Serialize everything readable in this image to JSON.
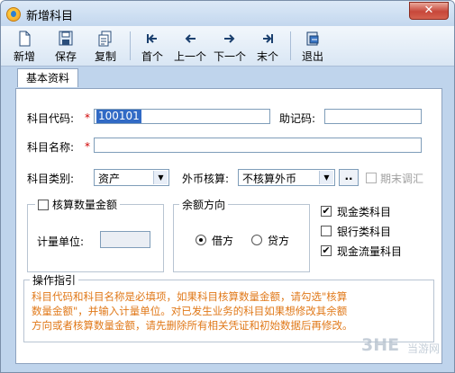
{
  "window": {
    "title": "新增科目",
    "close_label": "✕"
  },
  "toolbar": {
    "new": "新增",
    "save": "保存",
    "copy": "复制",
    "first": "首个",
    "prev": "上一个",
    "next": "下一个",
    "last": "末个",
    "exit": "退出"
  },
  "tab": {
    "basic": "基本资料"
  },
  "form": {
    "code_label": "科目代码:",
    "code_value": "100101",
    "mnemonic_label": "助记码:",
    "name_label": "科目名称:",
    "category_label": "科目类别:",
    "category_value": "资产",
    "currency_label": "外币核算:",
    "currency_value": "不核算外币",
    "dots_label": "..",
    "period_adjust_label": "期末调汇",
    "qty_group_label": "核算数量金额",
    "unit_label": "计量单位:",
    "balance_group_label": "余额方向",
    "debit_label": "借方",
    "credit_label": "贷方",
    "cash_label": "现金类科目",
    "bank_label": "银行类科目",
    "cashflow_label": "现金流量科目",
    "required_mark": "*",
    "check_mark": "✔"
  },
  "guide": {
    "title": "操作指引",
    "line1": "科目代码和科目名称是必填项，如果科目核算数量金额，请勾选\"核算",
    "line2": "数量金额\"，并输入计量单位。对已发生业务的科目如果想修改其余额",
    "line3": "方向或者核算数量金额，请先删除所有相关凭证和初始数据后再修改。"
  },
  "watermark": {
    "logo": "3HE",
    "text": "当游网"
  },
  "icons": [
    "new-icon",
    "save-icon",
    "copy-icon",
    "first-icon",
    "prev-icon",
    "next-icon",
    "last-icon",
    "exit-icon",
    "app-icon"
  ]
}
